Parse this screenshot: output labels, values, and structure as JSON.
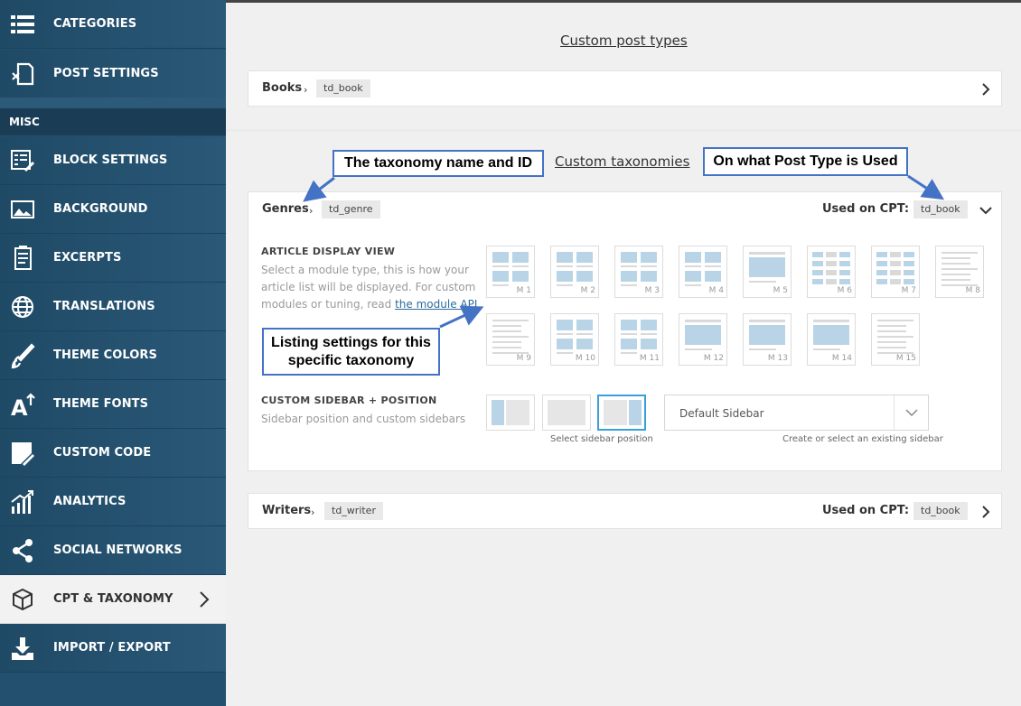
{
  "sidebar": {
    "misc_label": "MISC",
    "items": [
      {
        "label": "CATEGORIES",
        "icon": "list-icon"
      },
      {
        "label": "POST SETTINGS",
        "icon": "post-settings-icon"
      },
      {
        "label": "BLOCK SETTINGS",
        "icon": "block-settings-icon"
      },
      {
        "label": "BACKGROUND",
        "icon": "image-icon"
      },
      {
        "label": "EXCERPTS",
        "icon": "document-icon"
      },
      {
        "label": "TRANSLATIONS",
        "icon": "globe-icon"
      },
      {
        "label": "THEME COLORS",
        "icon": "brush-icon"
      },
      {
        "label": "THEME FONTS",
        "icon": "font-icon"
      },
      {
        "label": "CUSTOM CODE",
        "icon": "code-edit-icon"
      },
      {
        "label": "ANALYTICS",
        "icon": "analytics-icon"
      },
      {
        "label": "SOCIAL NETWORKS",
        "icon": "share-icon"
      },
      {
        "label": "CPT & TAXONOMY",
        "icon": "box-icon",
        "active": true
      },
      {
        "label": "IMPORT / EXPORT",
        "icon": "download-icon"
      }
    ]
  },
  "cpt": {
    "title": "Custom post types",
    "rows": [
      {
        "name": "Books",
        "id": "td_book"
      }
    ]
  },
  "taxonomies": {
    "title": "Custom taxonomies",
    "used_label": "Used on CPT:",
    "genres": {
      "name": "Genres",
      "id": "td_genre",
      "cpt": "td_book"
    },
    "writers": {
      "name": "Writers",
      "id": "td_writer",
      "cpt": "td_book"
    }
  },
  "article_view": {
    "title": "ARTICLE DISPLAY VIEW",
    "desc_1": "Select a module type, this is how your",
    "desc_2": "article list will be displayed. For custom",
    "desc_3": "modules or tuning, read",
    "link": "the module API",
    "modules": [
      "M 1",
      "M 2",
      "M 3",
      "M 4",
      "M 5",
      "M 6",
      "M 7",
      "M 8",
      "M 9",
      "M 10",
      "M 11",
      "M 12",
      "M 13",
      "M 14",
      "M 15"
    ]
  },
  "sidebar_position": {
    "title": "CUSTOM SIDEBAR + POSITION",
    "desc": "Sidebar position and custom sidebars",
    "position_hint": "Select sidebar position",
    "select_value": "Default Sidebar",
    "select_hint": "Create or select an existing sidebar"
  },
  "callouts": {
    "name_id": "The taxonomy name and ID",
    "post_type": "On what Post Type is Used",
    "listing_1": "Listing settings for this",
    "listing_2": "specific taxonomy"
  },
  "colors": {
    "sidebar": "#23506e",
    "accent": "#3aa0d8",
    "callout_border": "#4472c4"
  }
}
